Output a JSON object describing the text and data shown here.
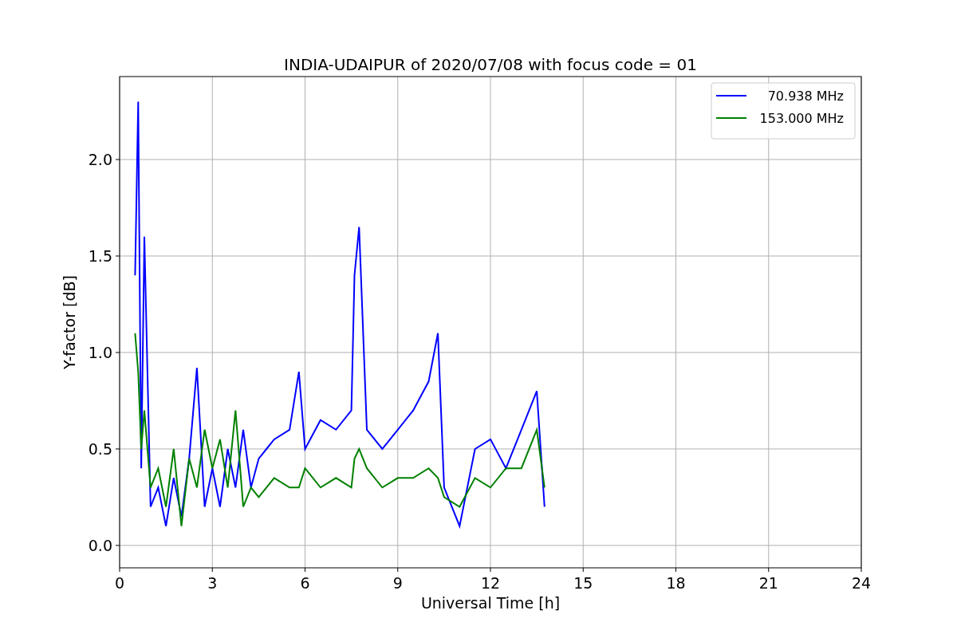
{
  "chart_data": {
    "type": "line",
    "title": "INDIA-UDAIPUR of 2020/07/08 with focus code = 01",
    "xlabel": "Universal Time [h]",
    "ylabel": "Y-factor [dB]",
    "x": [
      0.5,
      0.6,
      0.7,
      0.8,
      1.0,
      1.25,
      1.5,
      1.75,
      2.0,
      2.25,
      2.5,
      2.75,
      3.0,
      3.25,
      3.5,
      3.75,
      4.0,
      4.25,
      4.5,
      4.75,
      5.0,
      5.5,
      5.8,
      6.0,
      6.5,
      7.0,
      7.5,
      7.6,
      7.75,
      8.0,
      8.5,
      9.0,
      9.5,
      10.0,
      10.3,
      10.5,
      11.0,
      11.5,
      12.0,
      12.5,
      13.0,
      13.5,
      13.75
    ],
    "series": [
      {
        "name": "70.938 MHz",
        "color": "#0000ff",
        "values": [
          1.4,
          2.3,
          0.4,
          1.6,
          0.2,
          0.3,
          0.1,
          0.35,
          0.15,
          0.45,
          0.92,
          0.2,
          0.4,
          0.2,
          0.5,
          0.3,
          0.6,
          0.3,
          0.45,
          0.5,
          0.55,
          0.6,
          0.9,
          0.5,
          0.65,
          0.6,
          0.7,
          1.4,
          1.65,
          0.6,
          0.5,
          0.6,
          0.7,
          0.85,
          1.1,
          0.3,
          0.1,
          0.5,
          0.55,
          0.4,
          0.6,
          0.8,
          0.2
        ]
      },
      {
        "name": "153.000 MHz",
        "color": "#008000",
        "values": [
          1.1,
          0.9,
          0.5,
          0.7,
          0.3,
          0.4,
          0.2,
          0.5,
          0.1,
          0.45,
          0.3,
          0.6,
          0.4,
          0.55,
          0.3,
          0.7,
          0.2,
          0.3,
          0.25,
          0.3,
          0.35,
          0.3,
          0.3,
          0.4,
          0.3,
          0.35,
          0.3,
          0.45,
          0.5,
          0.4,
          0.3,
          0.35,
          0.35,
          0.4,
          0.35,
          0.25,
          0.2,
          0.35,
          0.3,
          0.4,
          0.4,
          0.6,
          0.3
        ]
      }
    ],
    "grid": true,
    "legend": true,
    "xlim": [
      0,
      24
    ],
    "ylim": [
      -0.116,
      2.43
    ],
    "xticks": [
      0,
      3,
      6,
      9,
      12,
      15,
      18,
      21,
      24
    ],
    "yticks": [
      {
        "value": 0,
        "label": "0.0"
      },
      {
        "value": 0.5,
        "label": "0.5"
      },
      {
        "value": 1,
        "label": "1.0"
      },
      {
        "value": 1.5,
        "label": "1.5"
      },
      {
        "value": 2,
        "label": "2.0"
      }
    ]
  }
}
